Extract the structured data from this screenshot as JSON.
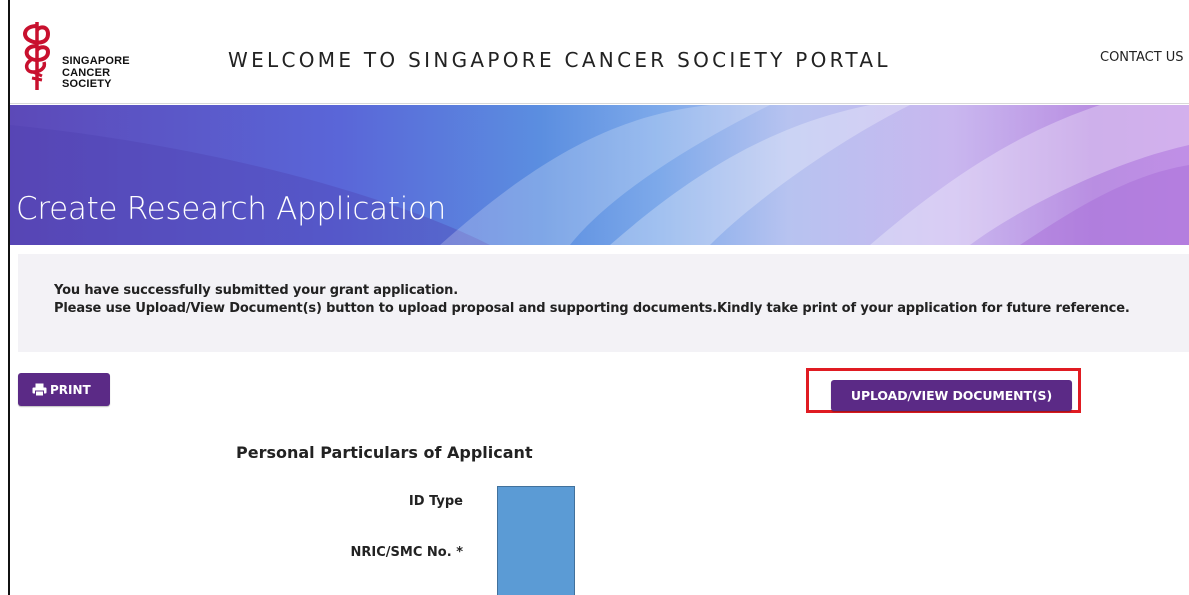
{
  "header": {
    "logo_lines": [
      "SINGAPORE",
      "CANCER",
      "SOCIETY"
    ],
    "welcome_text": "WELCOME TO SINGAPORE CANCER SOCIETY PORTAL",
    "contact_label": "CONTACT US"
  },
  "banner": {
    "title": "Create Research Application"
  },
  "message": {
    "line1": "You have successfully submitted your grant application.",
    "line2": "Please use Upload/View Document(s) button to upload proposal and supporting documents.Kindly take print of your application for future reference."
  },
  "actions": {
    "print_label": "PRINT",
    "upload_label": "UPLOAD/VIEW DOCUMENT(S)",
    "highlight_color": "#e01b22",
    "button_color": "#5b2a86"
  },
  "form": {
    "section_title": "Personal Particulars of Applicant",
    "fields": [
      {
        "label": "ID Type"
      },
      {
        "label": "NRIC/SMC No. *"
      }
    ],
    "redaction_color": "#5b9bd5"
  },
  "icons": {
    "logo": "sgcs-caduceus-icon",
    "print": "printer-icon"
  }
}
